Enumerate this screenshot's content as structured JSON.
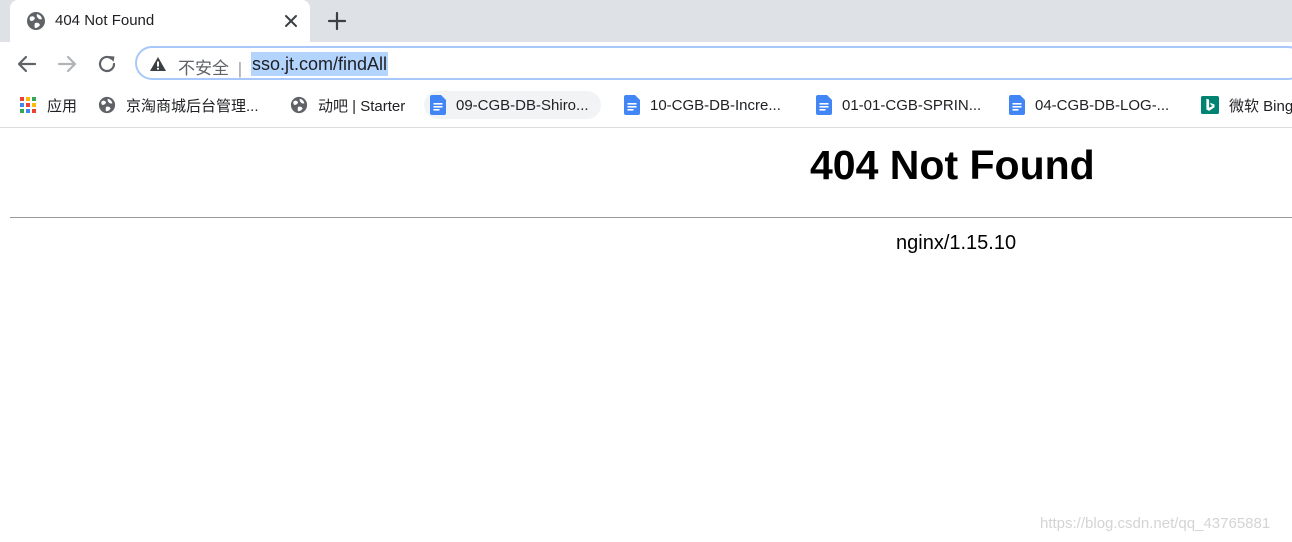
{
  "tabs": [
    {
      "title": "404 Not Found",
      "icon": "globe-icon",
      "active": true
    }
  ],
  "toolbar": {
    "back_icon": "back-arrow-icon",
    "forward_icon": "forward-arrow-icon",
    "reload_icon": "reload-icon",
    "security_label": "不安全",
    "separator": "|",
    "url": "sso.jt.com/findAll"
  },
  "bookmarks": [
    {
      "label": "应用",
      "icon": "apps-grid-icon"
    },
    {
      "label": "京淘商城后台管理...",
      "icon": "globe-icon"
    },
    {
      "label": "动吧 | Starter",
      "icon": "globe-icon"
    },
    {
      "label": "09-CGB-DB-Shiro...",
      "icon": "google-docs-icon"
    },
    {
      "label": "10-CGB-DB-Incre...",
      "icon": "google-docs-icon"
    },
    {
      "label": "01-01-CGB-SPRIN...",
      "icon": "google-docs-icon"
    },
    {
      "label": "04-CGB-DB-LOG-...",
      "icon": "google-docs-icon"
    },
    {
      "label": "微软 Bing",
      "icon": "bing-icon"
    }
  ],
  "page": {
    "heading": "404 Not Found",
    "server": "nginx/1.15.10"
  },
  "watermark": "https://blog.csdn.net/qq_43765881",
  "colors": {
    "tabstrip": "#dee1e6",
    "omnibox_focus": "#a8c7fa",
    "url_selection": "#b3d4fc",
    "docs_blue": "#4285f4",
    "bing_teal": "#008373"
  }
}
